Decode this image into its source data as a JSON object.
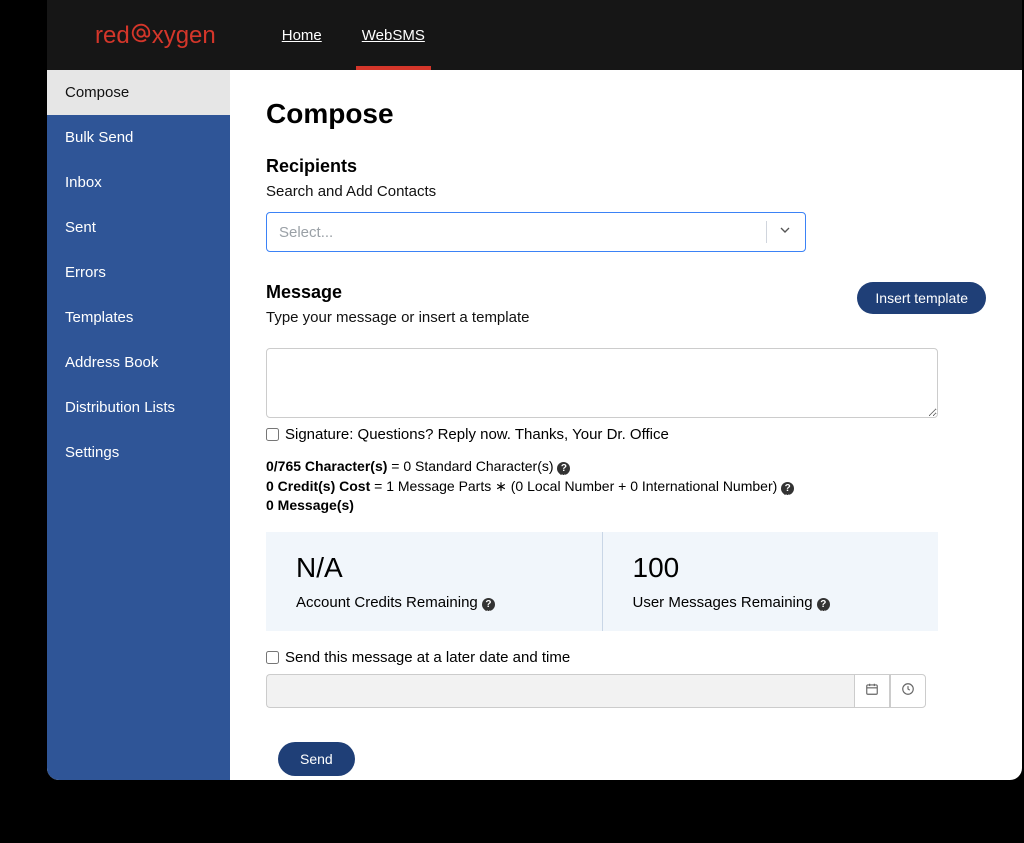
{
  "brand": {
    "part1": "red",
    "part2": "xygen"
  },
  "nav": {
    "home": "Home",
    "websms": "WebSMS"
  },
  "sidebar": {
    "items": [
      {
        "label": "Compose"
      },
      {
        "label": "Bulk Send"
      },
      {
        "label": "Inbox"
      },
      {
        "label": "Sent"
      },
      {
        "label": "Errors"
      },
      {
        "label": "Templates"
      },
      {
        "label": "Address Book"
      },
      {
        "label": "Distribution Lists"
      },
      {
        "label": "Settings"
      }
    ]
  },
  "page": {
    "title": "Compose"
  },
  "recipients": {
    "heading": "Recipients",
    "hint": "Search and Add Contacts",
    "placeholder": "Select..."
  },
  "message": {
    "heading": "Message",
    "hint": "Type your message or insert a template",
    "insert_template_btn": "Insert template",
    "signature_label": "Signature: Questions? Reply now. Thanks, Your Dr. Office"
  },
  "stats": {
    "char_bold": "0/765 Character(s)",
    "char_rest": " = 0 Standard Character(s) ",
    "credit_bold": "0 Credit(s) Cost",
    "credit_rest": " = 1 Message Parts ∗ (0 Local Number + 0 International Number) ",
    "msgs_bold": "0 Message(s)"
  },
  "cards": {
    "account_value": "N/A",
    "account_label": "Account Credits Remaining ",
    "user_value": "100",
    "user_label": "User Messages Remaining "
  },
  "schedule": {
    "label": "Send this message at a later date and time"
  },
  "send_btn": "Send"
}
